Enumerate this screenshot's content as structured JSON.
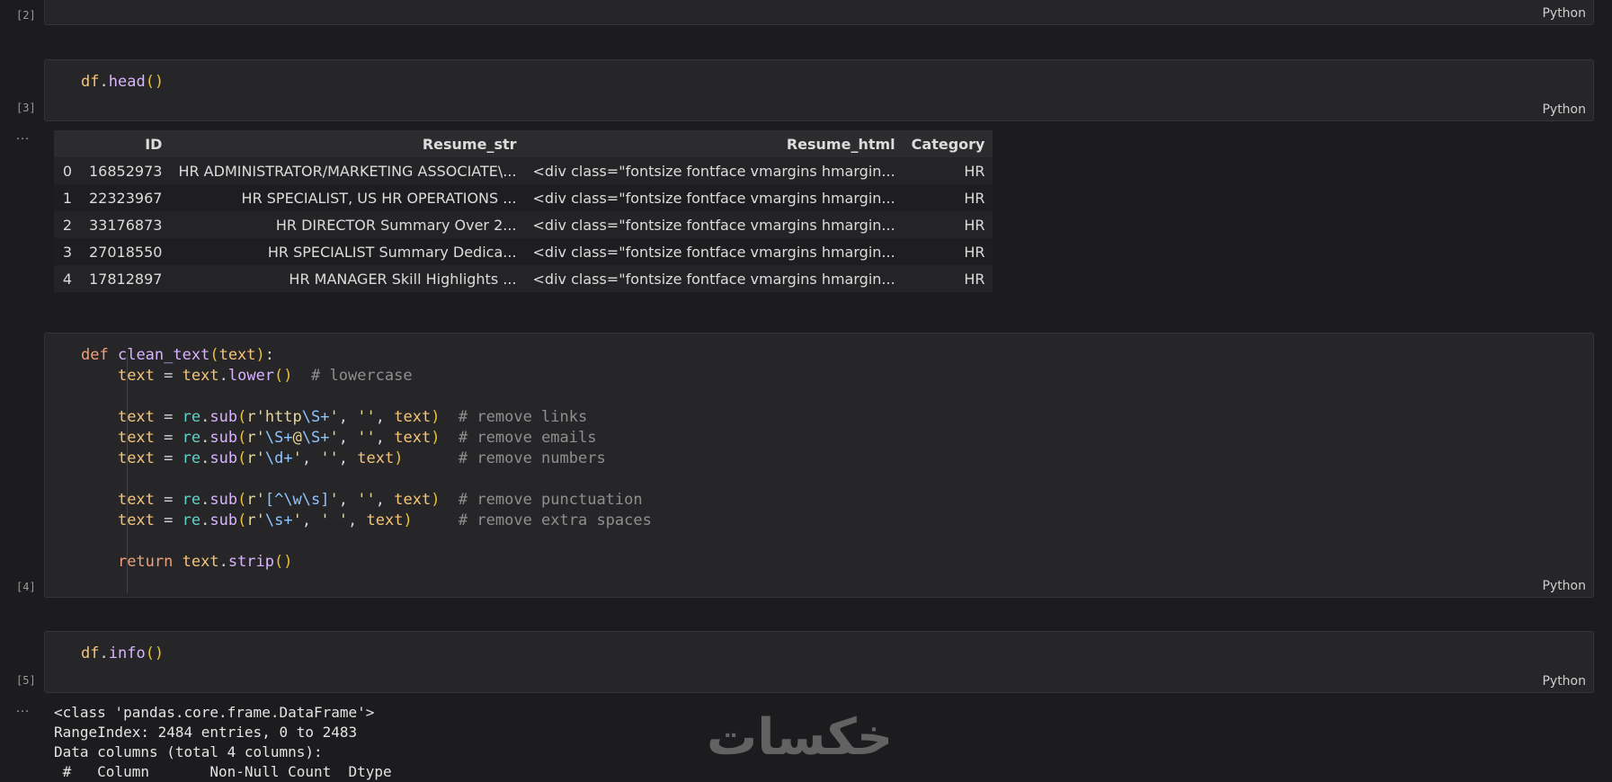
{
  "cells": [
    {
      "exec": "[2]",
      "lang": "Python"
    },
    {
      "exec": "[3]",
      "lang": "Python",
      "code": "df.head()"
    },
    {
      "exec": "[4]",
      "lang": "Python"
    },
    {
      "exec": "[5]",
      "lang": "Python",
      "code": "df.info()"
    }
  ],
  "more_icon": "…",
  "table": {
    "columns": [
      "",
      "ID",
      "Resume_str",
      "Resume_html",
      "Category"
    ],
    "rows": [
      [
        "0",
        "16852973",
        "HR ADMINISTRATOR/MARKETING ASSOCIATE\\...",
        "<div class=\"fontsize fontface vmargins hmargin...",
        "HR"
      ],
      [
        "1",
        "22323967",
        "HR SPECIALIST, US HR OPERATIONS ...",
        "<div class=\"fontsize fontface vmargins hmargin...",
        "HR"
      ],
      [
        "2",
        "33176873",
        "HR DIRECTOR Summary Over 2...",
        "<div class=\"fontsize fontface vmargins hmargin...",
        "HR"
      ],
      [
        "3",
        "27018550",
        "HR SPECIALIST Summary Dedica...",
        "<div class=\"fontsize fontface vmargins hmargin...",
        "HR"
      ],
      [
        "4",
        "17812897",
        "HR MANAGER Skill Highlights ...",
        "<div class=\"fontsize fontface vmargins hmargin...",
        "HR"
      ]
    ]
  },
  "clean_text_code": {
    "l1_def": "def",
    "l1_name": "clean_text",
    "l1_param": "text",
    "c_lower": "# lowercase",
    "c_links": "# remove links",
    "c_emails": "# remove emails",
    "c_numbers": "# remove numbers",
    "c_punct": "# remove punctuation",
    "c_spaces": "# remove extra spaces",
    "ret": "return"
  },
  "info_output": "<class 'pandas.core.frame.DataFrame'>\nRangeIndex: 2484 entries, 0 to 2483\nData columns (total 4 columns):\n #   Column       Non-Null Count  Dtype",
  "watermark": "خكسات"
}
